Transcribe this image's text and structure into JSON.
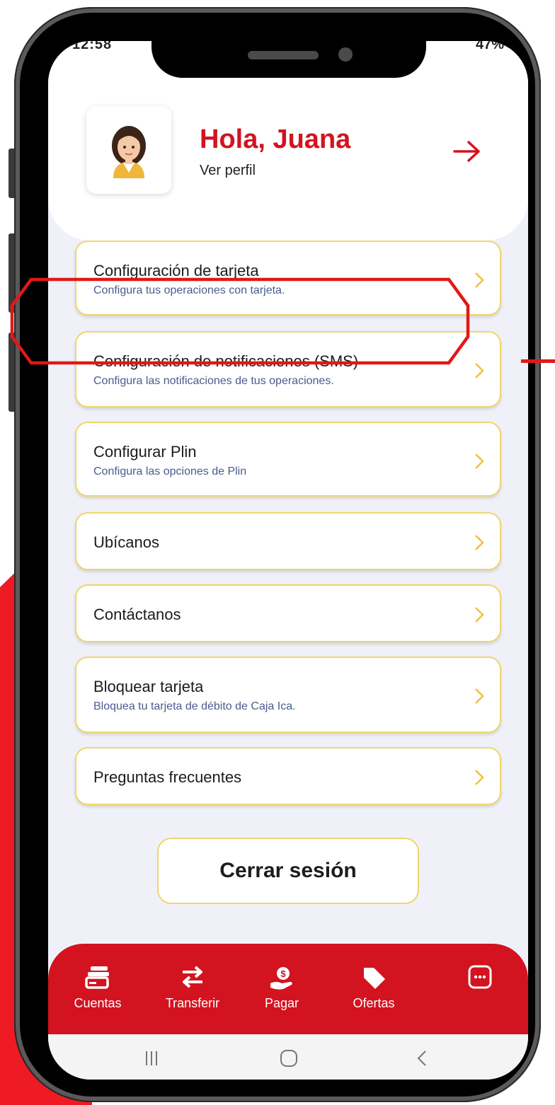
{
  "status_bar": {
    "time": "12:58",
    "battery": "47%"
  },
  "header": {
    "greeting": "Hola, Juana",
    "profile_link": "Ver perfil"
  },
  "menu": [
    {
      "title": "Configuración de tarjeta",
      "subtitle": "Configura tus operaciones con tarjeta."
    },
    {
      "title": "Configuración de notificaciones (SMS)",
      "subtitle": "Configura las notificaciones de tus operaciones."
    },
    {
      "title": "Configurar Plin",
      "subtitle": "Configura las opciones de Plin"
    },
    {
      "title": "Ubícanos"
    },
    {
      "title": "Contáctanos"
    },
    {
      "title": "Bloquear tarjeta",
      "subtitle": "Bloquea tu tarjeta de débito de Caja Ica."
    },
    {
      "title": "Preguntas frecuentes"
    }
  ],
  "logout_label": "Cerrar sesión",
  "tabbar": [
    {
      "label": "Cuentas",
      "icon": "cards-icon"
    },
    {
      "label": "Transferir",
      "icon": "transfer-arrows-icon"
    },
    {
      "label": "Pagar",
      "icon": "pay-hand-coin-icon"
    },
    {
      "label": "Ofertas",
      "icon": "tag-icon"
    },
    {
      "label": "",
      "icon": "more-dots-icon"
    }
  ],
  "colors": {
    "brand_red": "#d3131f",
    "card_border": "#efd56b",
    "subtitle": "#4a5c8c"
  }
}
